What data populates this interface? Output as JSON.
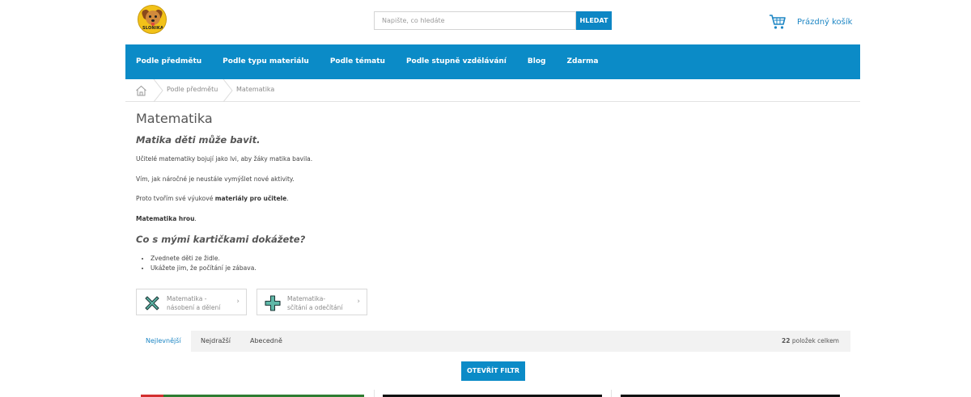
{
  "header": {
    "logo_text": "SLONIKA",
    "search": {
      "placeholder": "Napište, co hledáte",
      "button_label": "HLEDAT"
    },
    "cart": {
      "label": "Prázdný košík",
      "icon": "cart-icon"
    }
  },
  "nav": {
    "items": [
      {
        "label": "Podle předmětu"
      },
      {
        "label": "Podle typu materiálu"
      },
      {
        "label": "Podle tématu"
      },
      {
        "label": "Podle stupně vzdělávání"
      },
      {
        "label": "Blog"
      },
      {
        "label": "Zdarma"
      }
    ]
  },
  "breadcrumb": {
    "home_icon": "home-icon",
    "items": [
      {
        "label": "Podle předmětu"
      },
      {
        "label": "Matematika"
      }
    ]
  },
  "content": {
    "title": "Matematika",
    "subtitle": "Matika děti může bavit.",
    "paragraphs": {
      "p1": "Učitelé matematiky bojují jako lvi, aby žáky matika bavila.",
      "p2": "Vím, jak náročné je neustále vymýšlet nové aktivity.",
      "p3_prefix": "Proto tvořím své výukové ",
      "p3_bold": "materiály pro učitele",
      "p3_suffix": ".",
      "p4_bold": "Matematika hrou",
      "p4_suffix": "."
    },
    "heading2": "Co s mými kartičkami dokážete?",
    "bullets": [
      "Zvednete děti ze židle.",
      "Ukážete jim, že počítání je zábava."
    ],
    "categories": [
      {
        "label_line1": "Matematika -",
        "label_line2": "násobení a dělení",
        "icon": "multiply-icon"
      },
      {
        "label_line1": "Matematika-",
        "label_line2": "sčítání a odečítání",
        "icon": "plus-icon"
      }
    ]
  },
  "sorting": {
    "tabs": [
      {
        "label": "Nejlevnější",
        "active": true
      },
      {
        "label": "Nejdražší"
      },
      {
        "label": "Abecedně"
      }
    ],
    "count_number": "22",
    "count_suffix": " položek celkem"
  },
  "filter_button": "OTEVŘÍT FILTR",
  "colors": {
    "primary": "#0b8bc7",
    "link": "#1d86c4",
    "logo": "#f2c218"
  }
}
